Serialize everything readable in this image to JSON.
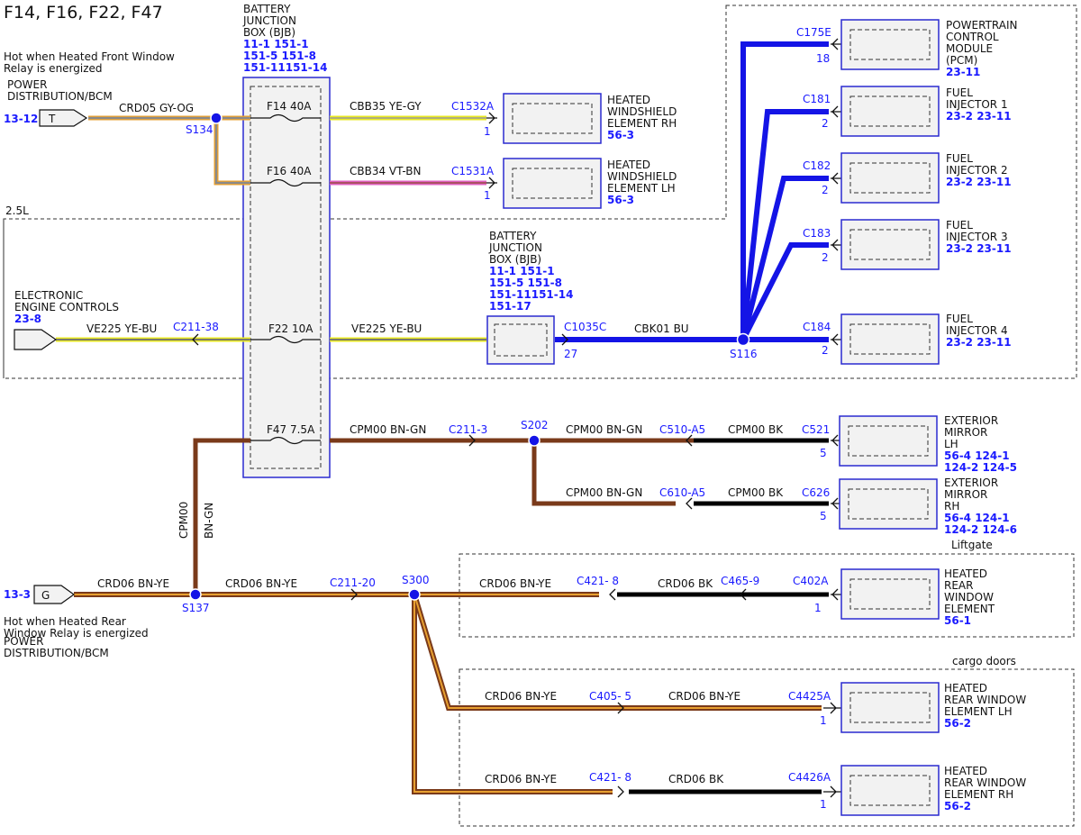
{
  "title": "F14, F16, F22, F47",
  "bjb_top": {
    "lines": [
      "BATTERY",
      "JUNCTION",
      "BOX (BJB)"
    ],
    "refs": [
      "11-1   151-1",
      "151-5 151-8",
      "151-11151-14"
    ]
  },
  "bjb_mid": {
    "lines": [
      "BATTERY",
      "JUNCTION",
      "BOX (BJB)"
    ],
    "refs": [
      "11-1   151-1",
      "151-5 151-8",
      "151-11151-14",
      "151-17"
    ]
  },
  "zones": {
    "engine": "2.5L",
    "liftgate": "Liftgate",
    "cargo": "cargo doors"
  },
  "sources": {
    "front_window": {
      "desc": [
        "Hot when Heated Front Window",
        "Relay is energized"
      ],
      "name": [
        "POWER",
        "DISTRIBUTION/BCM"
      ],
      "ref": "13-12",
      "pin": "T"
    },
    "rear_window": {
      "desc": [
        "Hot when Heated Rear",
        "Window Relay is energized"
      ],
      "name": [
        "POWER",
        "DISTRIBUTION/BCM"
      ],
      "ref": "13-3",
      "pin": "G"
    },
    "eec": {
      "name": [
        "ELECTRONIC",
        "ENGINE CONTROLS"
      ],
      "ref": "23-8"
    }
  },
  "fuses": {
    "f14": "F14   40A",
    "f16": "F16   40A",
    "f22": "F22   10A",
    "f47": "F47   7.5A"
  },
  "splices": {
    "s134": "S134",
    "s116": "S116",
    "s202": "S202",
    "s137": "S137",
    "s300": "S300"
  },
  "wires": {
    "crd05": "CRD05   GY-OG",
    "cbb35": "CBB35   YE-GY",
    "cbb34": "CBB34   VT-BN",
    "ve225a": "VE225   YE-BU",
    "ve225b": "VE225   YE-BU",
    "cbk01": "CBK01   BU",
    "cpm00_1": "CPM00   BN-GN",
    "cpm00_2": "CPM00   BN-GN",
    "cpm00_3": "CPM00   BN-GN",
    "cpm00_bk1": "CPM00   BK",
    "cpm00_bk2": "CPM00   BK",
    "cpm00_v1": "CPM00",
    "cpm00_v2": "BN-GN",
    "crd06_1": "CRD06   BN-YE",
    "crd06_2": "CRD06   BN-YE",
    "crd06_3": "CRD06   BN-YE",
    "crd06_bk1": "CRD06   BK",
    "crd06_4": "CRD06   BN-YE",
    "crd06_5": "CRD06   BN-YE",
    "crd06_6": "CRD06   BN-YE",
    "crd06_bk2": "CRD06   BK"
  },
  "connectors": {
    "c1532a": "C1532A",
    "c1531a": "C1531A",
    "c211_38": "C211-38",
    "c1035c": "C1035C",
    "c175e": "C175E",
    "c181": "C181",
    "c182": "C182",
    "c183": "C183",
    "c184": "C184",
    "c211_3": "C211-3",
    "c510": "C510-A5",
    "c521": "C521",
    "c610": "C610-A5",
    "c626": "C626",
    "c211_20": "C211-20",
    "c421_8a": "C421- 8",
    "c465": "C465-9",
    "c402a": "C402A",
    "c405": "C405- 5",
    "c4425a": "C4425A",
    "c421_8b": "C421- 8",
    "c4426a": "C4426A"
  },
  "pins": {
    "c1532a": "1",
    "c1531a": "1",
    "c1035c": "27",
    "c175e": "18",
    "c181": "2",
    "c182": "2",
    "c183": "2",
    "c184": "2",
    "c521": "5",
    "c626": "5",
    "c402a": "1",
    "c4425a": "1",
    "c4426a": "1"
  },
  "modules": {
    "ws_rh": {
      "lines": [
        "HEATED",
        "WINDSHIELD",
        "ELEMENT RH"
      ],
      "ref": "56-3"
    },
    "ws_lh": {
      "lines": [
        "HEATED",
        "WINDSHIELD",
        "ELEMENT LH"
      ],
      "ref": "56-3"
    },
    "pcm": {
      "lines": [
        "POWERTRAIN",
        "CONTROL",
        "MODULE",
        "(PCM)"
      ],
      "ref": "23-11"
    },
    "inj1": {
      "lines": [
        "FUEL",
        "INJECTOR 1"
      ],
      "ref": "23-2   23-11"
    },
    "inj2": {
      "lines": [
        "FUEL",
        "INJECTOR 2"
      ],
      "ref": "23-2   23-11"
    },
    "inj3": {
      "lines": [
        "FUEL",
        "INJECTOR 3"
      ],
      "ref": "23-2   23-11"
    },
    "inj4": {
      "lines": [
        "FUEL",
        "INJECTOR 4"
      ],
      "ref": "23-2   23-11"
    },
    "mir_lh": {
      "lines": [
        "EXTERIOR",
        "MIRROR",
        "LH"
      ],
      "refs": [
        "56-4   124-1",
        "124-2 124-5"
      ]
    },
    "mir_rh": {
      "lines": [
        "EXTERIOR",
        "MIRROR",
        "RH"
      ],
      "refs": [
        "56-4   124-1",
        "124-2 124-6"
      ]
    },
    "rear_win": {
      "lines": [
        "HEATED",
        "REAR",
        "WINDOW",
        "ELEMENT"
      ],
      "ref": "56-1"
    },
    "rw_lh": {
      "lines": [
        "HEATED",
        "REAR WINDOW",
        "ELEMENT LH"
      ],
      "ref": "56-2"
    },
    "rw_rh": {
      "lines": [
        "HEATED",
        "REAR WINDOW",
        "ELEMENT RH"
      ],
      "ref": "56-2"
    }
  },
  "colors": {
    "blue": "#1414e6",
    "brown": "#7a3a1a",
    "black": "#000000",
    "orange": "#e8a030",
    "yellow": "#e8e820",
    "gray": "#9a9a9a",
    "pink": "#e060c0",
    "label_blue": "#1a1aff"
  }
}
